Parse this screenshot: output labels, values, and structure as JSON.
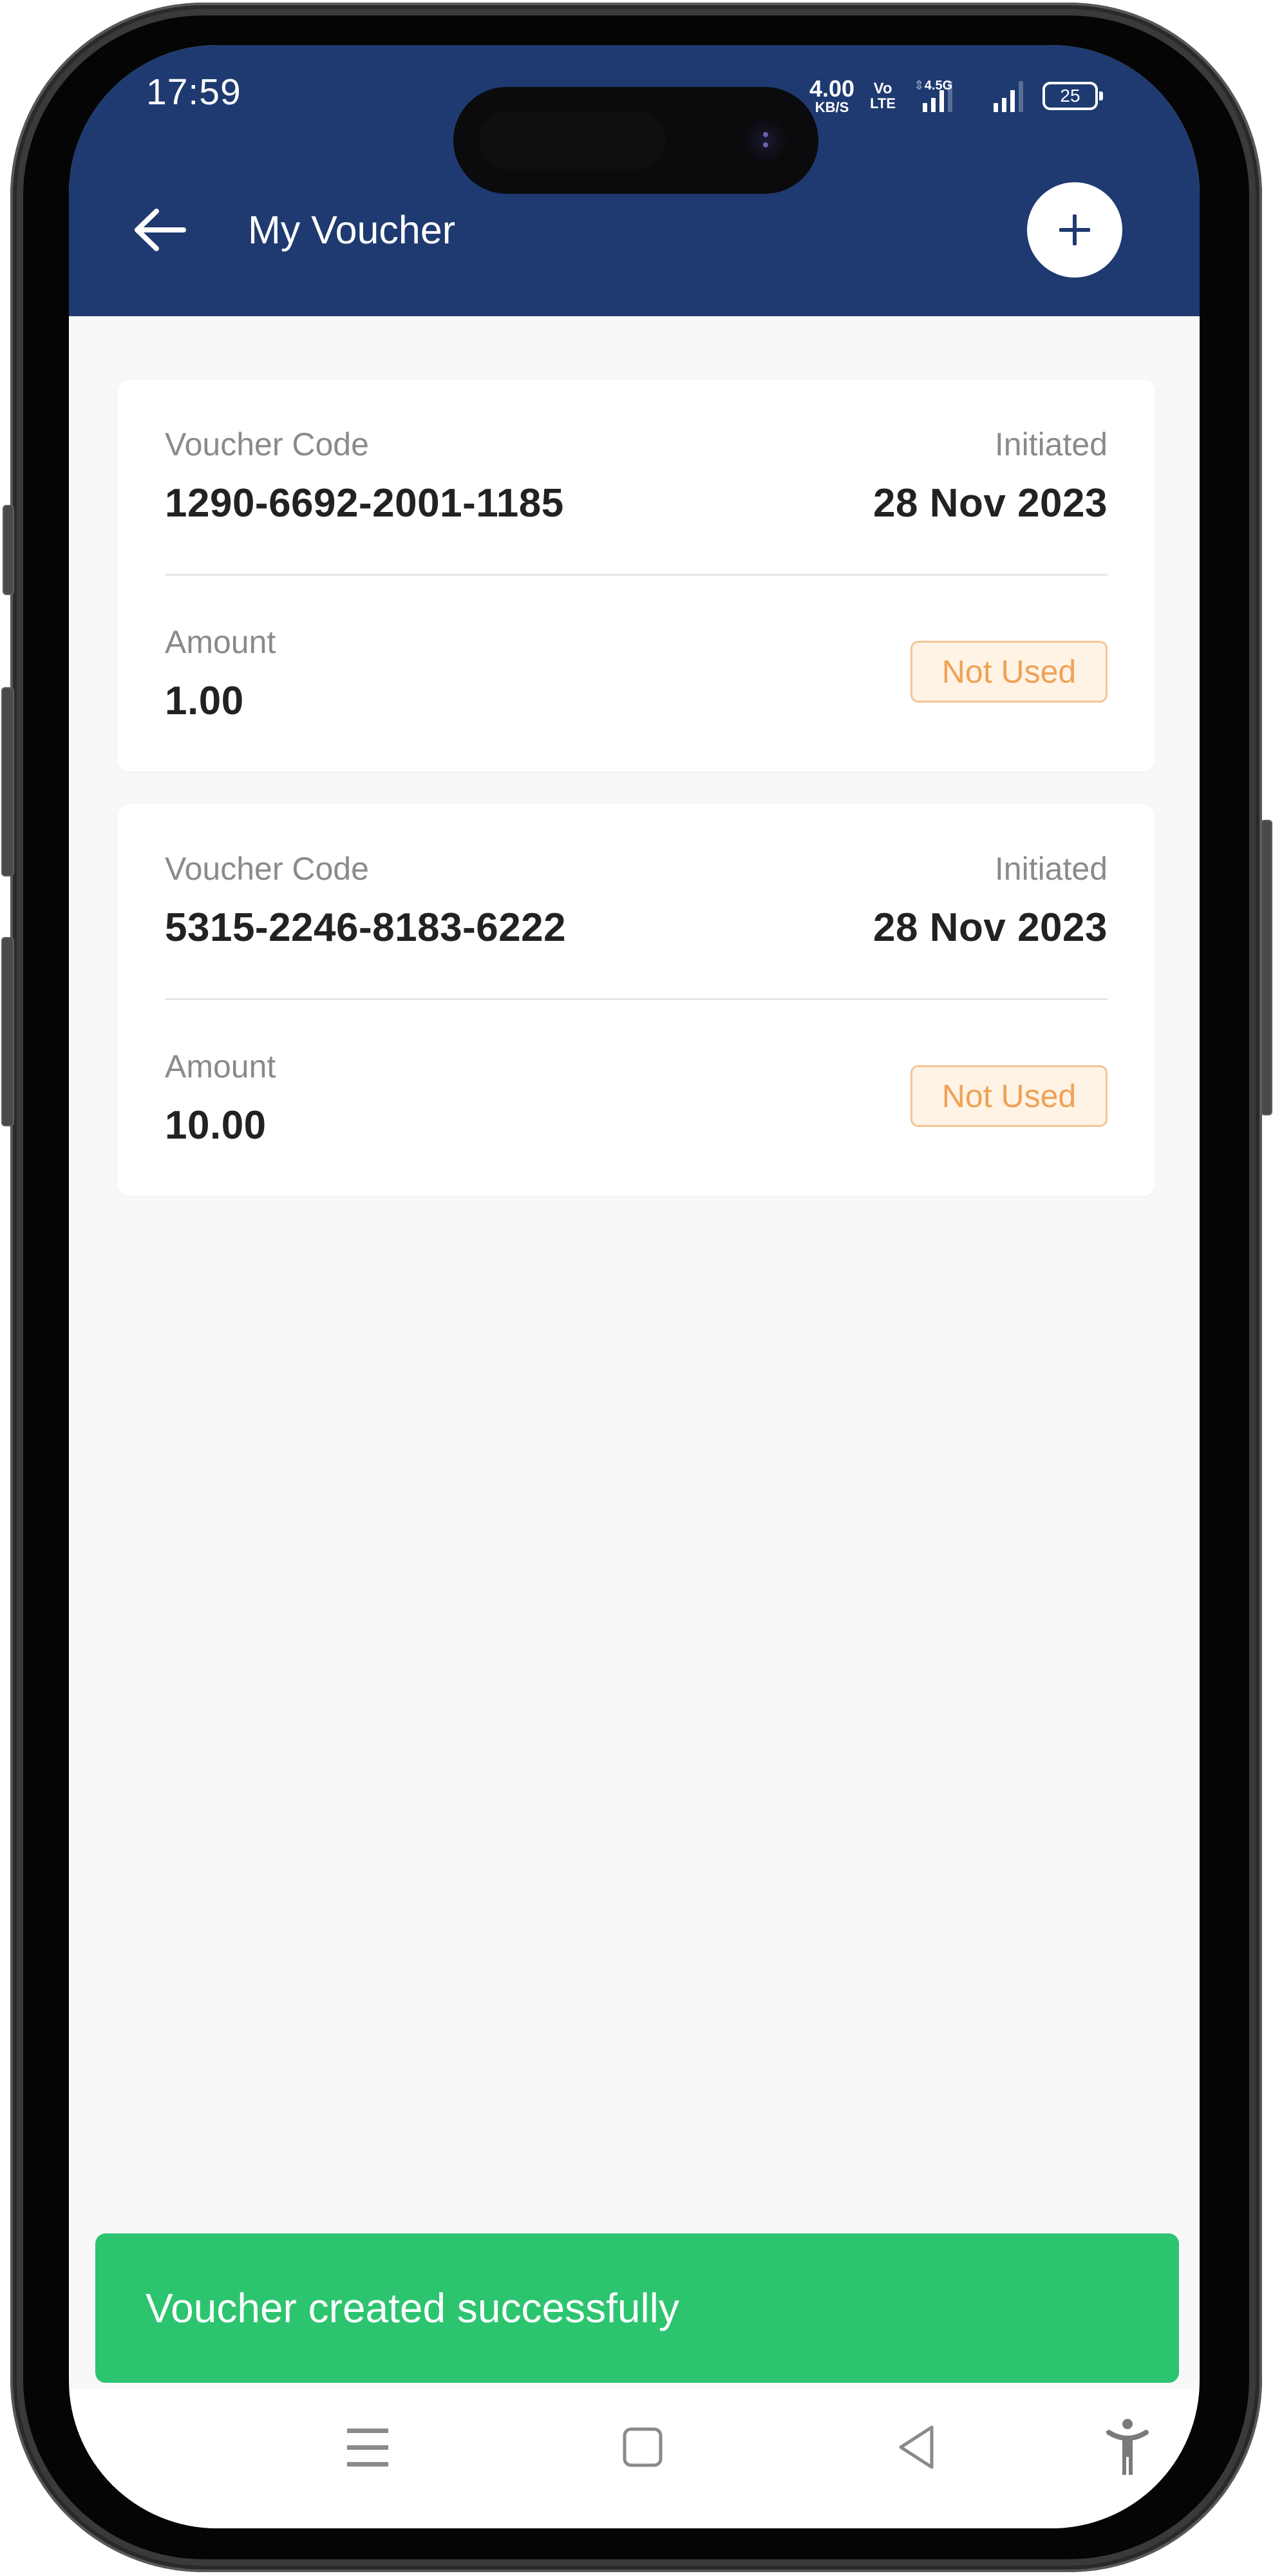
{
  "status_bar": {
    "time": "17:59",
    "net_speed_value": "4.00",
    "net_speed_unit": "KB/S",
    "volte_top": "Vo",
    "volte_bottom": "LTE",
    "network_type": "4.5G",
    "battery_level": "25"
  },
  "header": {
    "title": "My Voucher",
    "back_icon": "arrow-left-icon",
    "add_icon": "plus-icon"
  },
  "vouchers": [
    {
      "code_label": "Voucher Code",
      "code": "1290-6692-2001-1185",
      "date_label": "Initiated",
      "date": "28 Nov 2023",
      "amount_label": "Amount",
      "amount": "1.00",
      "status": "Not Used"
    },
    {
      "code_label": "Voucher Code",
      "code": "5315-2246-8183-6222",
      "date_label": "Initiated",
      "date": "28 Nov 2023",
      "amount_label": "Amount",
      "amount": "10.00",
      "status": "Not Used"
    }
  ],
  "toast": {
    "message": "Voucher created successfully"
  },
  "nav_bar": {
    "items": [
      "menu-icon",
      "home-icon",
      "back-icon",
      "accessibility-icon"
    ]
  },
  "colors": {
    "header": "#1e3a70",
    "toast": "#2dc470",
    "badge_text": "#f0a154",
    "badge_bg": "#fff3e6",
    "page_bg": "#f8f8f8"
  }
}
